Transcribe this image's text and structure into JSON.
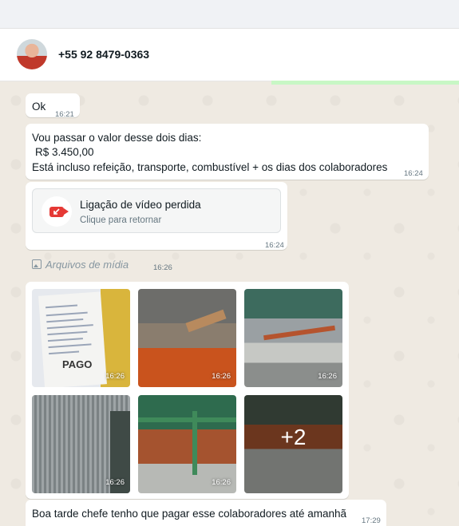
{
  "contact": {
    "name": "+55 92 8479-0363"
  },
  "messages": [
    {
      "text": "Ok",
      "time": "16:21"
    },
    {
      "lines": [
        "Vou passar o valor desse dois dias:",
        "R$ 3.450,00",
        "Está incluso refeição, transporte, combustível + os dias dos colaboradores"
      ],
      "time": "16:24"
    },
    {
      "call_title": "Ligação de vídeo perdida",
      "call_sub": "Clique para retornar",
      "time": "16:24"
    }
  ],
  "media": {
    "label": "Arquivos de mídia",
    "time": "16:26",
    "tiles": [
      {
        "time": "16:26",
        "text": "PAGO"
      },
      {
        "time": "16:26"
      },
      {
        "time": "16:26"
      },
      {
        "time": "16:26"
      },
      {
        "time": "16:26"
      },
      {
        "more": "+2"
      }
    ]
  },
  "last_message": {
    "text": "Boa tarde chefe tenho que pagar esse colaboradores até amanhã",
    "time": "17:29"
  },
  "colors": {
    "bubble": "#ffffff",
    "background": "#efeae2",
    "missed_call": "#e53935"
  }
}
